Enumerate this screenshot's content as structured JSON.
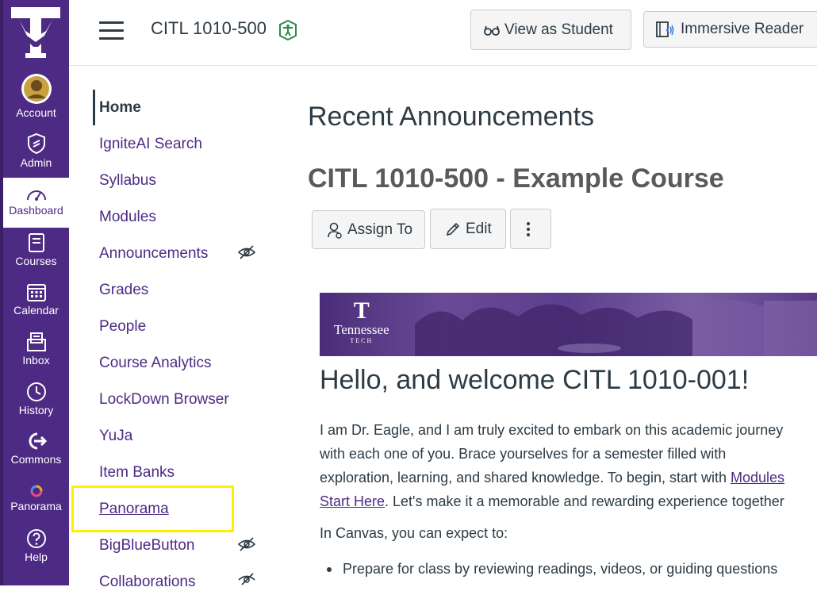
{
  "global_nav": {
    "logo": "tennessee-tech-eagle-logo",
    "items": [
      {
        "label": "Account",
        "icon": "account-avatar"
      },
      {
        "label": "Admin",
        "icon": "shield-icon"
      },
      {
        "label": "Dashboard",
        "icon": "dashboard-icon"
      },
      {
        "label": "Courses",
        "icon": "courses-icon"
      },
      {
        "label": "Calendar",
        "icon": "calendar-icon"
      },
      {
        "label": "Inbox",
        "icon": "inbox-icon"
      },
      {
        "label": "History",
        "icon": "history-icon"
      },
      {
        "label": "Commons",
        "icon": "commons-icon"
      },
      {
        "label": "Panorama",
        "icon": "panorama-icon"
      },
      {
        "label": "Help",
        "icon": "help-icon"
      }
    ],
    "active": "Dashboard"
  },
  "topbar": {
    "course_code": "CITL 1010-500",
    "view_as_student": "View as Student",
    "immersive_reader": "Immersive Reader"
  },
  "course_nav": {
    "items": [
      {
        "label": "Home",
        "hidden": false
      },
      {
        "label": "IgniteAI Search",
        "hidden": false
      },
      {
        "label": "Syllabus",
        "hidden": false
      },
      {
        "label": "Modules",
        "hidden": false
      },
      {
        "label": "Announcements",
        "hidden": true
      },
      {
        "label": "Grades",
        "hidden": false
      },
      {
        "label": "People",
        "hidden": false
      },
      {
        "label": "Course Analytics",
        "hidden": false
      },
      {
        "label": "LockDown Browser",
        "hidden": false
      },
      {
        "label": "YuJa",
        "hidden": false
      },
      {
        "label": "Item Banks",
        "hidden": false
      },
      {
        "label": "Panorama",
        "hidden": false
      },
      {
        "label": "BigBlueButton",
        "hidden": true
      },
      {
        "label": "Collaborations",
        "hidden": true
      }
    ],
    "active": "Home",
    "highlighted": "Panorama"
  },
  "main": {
    "recent_heading": "Recent Announcements",
    "page_title": "CITL 1010-500 - Example Course",
    "assign_to": "Assign To",
    "edit": "Edit",
    "banner_brand": {
      "letter": "T",
      "name": "Tennessee",
      "sub": "TECH"
    },
    "welcome": "Hello, and welcome CITL 1010-001!",
    "para_line1": "I am Dr. Eagle, and I am truly excited to embark on this academic journey",
    "para_line2": "with each one of you. Brace yourselves for a semester filled with",
    "para_line3_pre": "exploration, learning, and shared knowledge. To begin, start with ",
    "para_link1": "Modules",
    "para_link2": "Start Here",
    "para_line4_post": ". Let's make it a memorable and rewarding experience together",
    "expect": "In Canvas, you can expect to:",
    "bullet1": "Prepare for class by reviewing readings, videos, or guiding questions"
  },
  "colors": {
    "nav_purple": "#4d2a84",
    "highlight_yellow": "#ffee00",
    "link_purple": "#4d2a84"
  }
}
